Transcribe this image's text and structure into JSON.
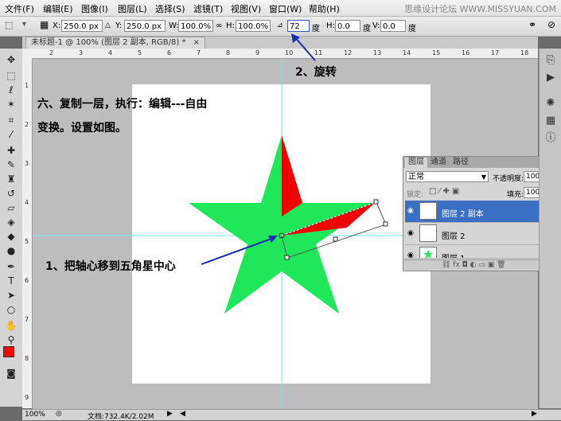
{
  "menu": [
    "文件(F)",
    "编辑(E)",
    "图像(I)",
    "图层(L)",
    "选择(S)",
    "滤镜(T)",
    "视图(V)",
    "窗口(W)",
    "帮助(H)"
  ],
  "watermark": "思缘设计论坛 WWW.MISSYUAN.COM",
  "options": {
    "x_label": "X:",
    "x_value": "250.0 px",
    "y_label": "Y:",
    "y_value": "250.0 px",
    "w_label": "W:",
    "w_value": "100.0%",
    "h_label": "H:",
    "h_value": "100.0%",
    "angle_value": "72",
    "angle_unit": "度",
    "hskew_label": "H:",
    "hskew_value": "0.0",
    "hskew_unit": "度",
    "vskew_label": "V:",
    "vskew_value": "0.0",
    "vskew_unit": "度"
  },
  "doc_tab": "未标题-1 @ 100% (图层 2 副本, RGB/8) *",
  "ruler_top": [
    "2",
    "3",
    "4",
    "5",
    "6",
    "7",
    "8",
    "9",
    "10",
    "11",
    "12",
    "13",
    "14",
    "15",
    "16",
    "17",
    "18"
  ],
  "ruler_left": [
    "1",
    "2",
    "3",
    "4",
    "5",
    "6",
    "7",
    "8",
    "9"
  ],
  "annotations": {
    "step6_line1": "六、复制一层，执行：编辑---自由",
    "step6_line2": "变换。设置如图。",
    "rotate": "2、旋转",
    "pivot": "1、把轴心移到五角星中心"
  },
  "layers_panel": {
    "tabs": [
      "图层",
      "通道",
      "路径"
    ],
    "blend_mode": "正常",
    "opacity_label": "不透明度:",
    "opacity_value": "100%",
    "lock_label": "锁定:",
    "fill_label": "填充:",
    "fill_value": "100%",
    "layers": [
      {
        "name": "图层 2 副本",
        "selected": true
      },
      {
        "name": "图层 2",
        "selected": false
      },
      {
        "name": "图层 1",
        "selected": false
      }
    ]
  },
  "status": {
    "zoom": "100%",
    "doc_info": "文档:732.4K/2.02M"
  },
  "colors": {
    "star_green": "#1ee85a",
    "star_red": "#f00000",
    "arrow_blue": "#1a2fb0",
    "selection_blue": "#3a6fc2",
    "guide_cyan": "#6ee6f0"
  }
}
